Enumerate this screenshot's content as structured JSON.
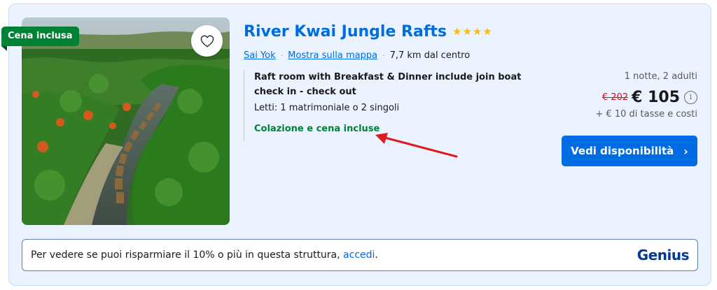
{
  "listing": {
    "badge": "Cena inclusa",
    "title": "River Kwai Jungle Rafts",
    "stars": "★★★★",
    "star_count": 4,
    "location_link": "Sai Yok",
    "map_link": "Mostra sulla mappa",
    "separator": "·",
    "distance": "7,7 km dal centro"
  },
  "room": {
    "name": "Raft room with Breakfast & Dinner include join boat check in - check out",
    "beds": "Letti: 1 matrimoniale o 2 singoli",
    "meals": "Colazione e cena incluse"
  },
  "price": {
    "stay": "1 notte, 2 adulti",
    "old": "€ 202",
    "current": "€ 105",
    "info_glyph": "i",
    "taxes": "+ € 10 di tasse e costi"
  },
  "cta": {
    "label": "Vedi disponibilità",
    "chevron": "›"
  },
  "genius": {
    "text": "Per vedere se puoi risparmiare il 10% o più in questa struttura, ",
    "link": "accedi",
    "period": ".",
    "logo": "Genius"
  },
  "colors": {
    "brand_blue": "#006ce4",
    "green": "#008234",
    "card_bg": "#eaf3ff",
    "star": "#febb02",
    "strike": "#d4111e",
    "arrow": "#e0191f"
  }
}
